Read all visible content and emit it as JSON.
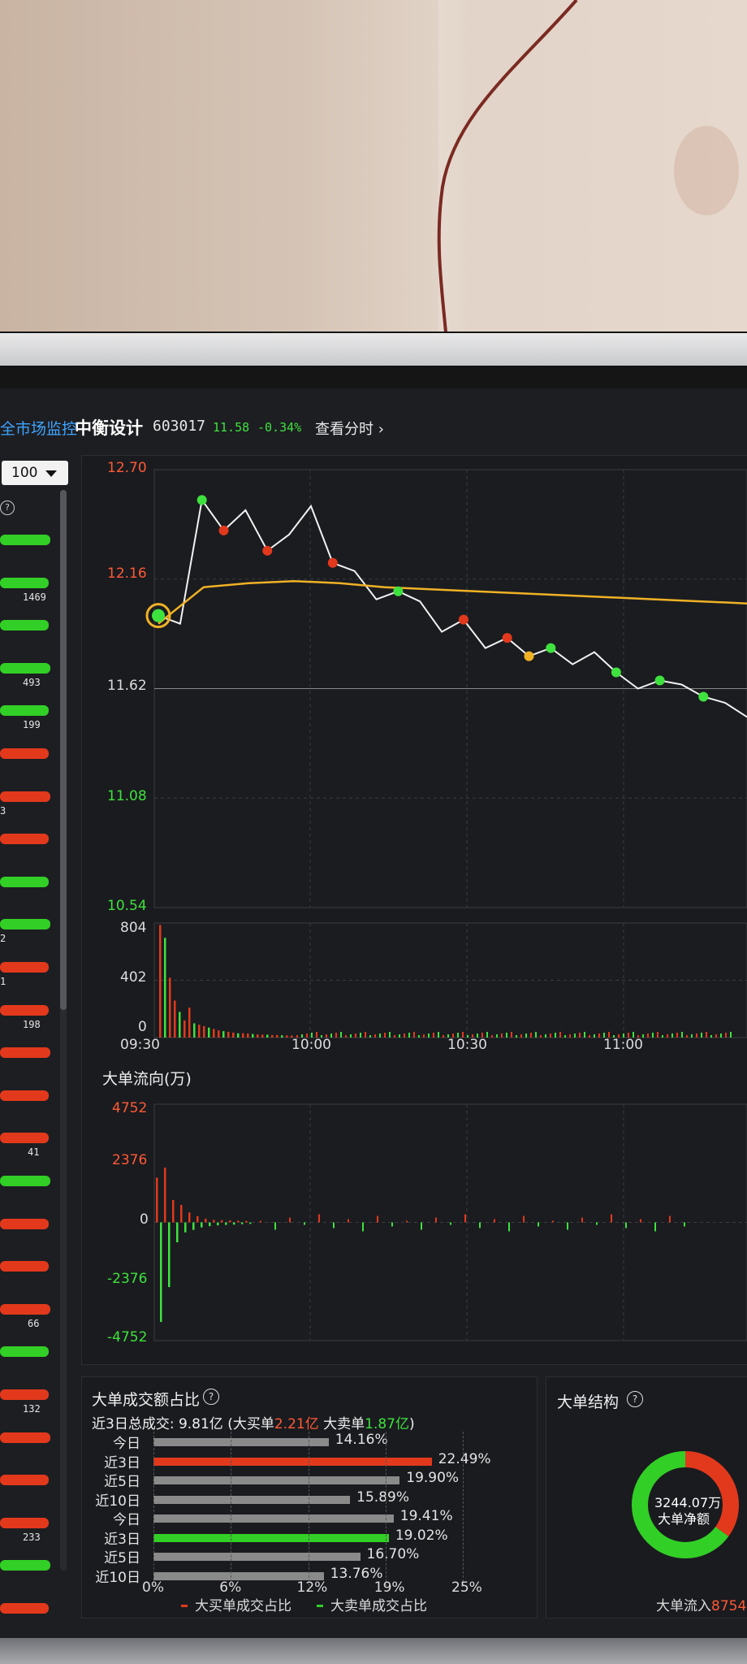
{
  "header": {
    "nav_link": "全市场监控",
    "stock_name": "中衡设计",
    "stock_code": "603017",
    "price": "11.58",
    "change": "-0.34%",
    "view_label": "查看分时 ›"
  },
  "left_panel": {
    "select_value": "100",
    "rows": [
      {
        "color": "green",
        "num": ""
      },
      {
        "color": "green",
        "num": "1469"
      },
      {
        "color": "green",
        "num": ""
      },
      {
        "color": "green",
        "num": "493"
      },
      {
        "color": "green",
        "num": "199"
      },
      {
        "color": "red",
        "num": ""
      },
      {
        "color": "red",
        "num": "3"
      },
      {
        "color": "red",
        "num": ""
      },
      {
        "color": "green",
        "num": ""
      },
      {
        "color": "green",
        "num": "2"
      },
      {
        "color": "red",
        "num": "1"
      },
      {
        "color": "red",
        "num": "198"
      },
      {
        "color": "red",
        "num": ""
      },
      {
        "color": "red",
        "num": ""
      },
      {
        "color": "red",
        "num": "41"
      },
      {
        "color": "green",
        "num": ""
      },
      {
        "color": "red",
        "num": ""
      },
      {
        "color": "red",
        "num": ""
      },
      {
        "color": "red",
        "num": "66"
      },
      {
        "color": "green",
        "num": ""
      },
      {
        "color": "red",
        "num": "132"
      },
      {
        "color": "red",
        "num": ""
      },
      {
        "color": "red",
        "num": ""
      },
      {
        "color": "red",
        "num": "233"
      },
      {
        "color": "green",
        "num": ""
      },
      {
        "color": "red",
        "num": ""
      }
    ]
  },
  "chart_data": [
    {
      "type": "line",
      "title": "",
      "y_ticks": [
        "12.70",
        "12.16",
        "11.62",
        "11.08",
        "10.54"
      ],
      "ylim": [
        10.54,
        12.7
      ],
      "x_ticks": [
        "09:30",
        "10:00",
        "10:30",
        "11:00"
      ],
      "series": [
        {
          "values": [
            11.98,
            11.94,
            12.55,
            12.4,
            12.5,
            12.3,
            12.38,
            12.52,
            12.24,
            12.2,
            12.06,
            12.1,
            12.05,
            11.9,
            11.96,
            11.82,
            11.87,
            11.78,
            11.82,
            11.74,
            11.8,
            11.7,
            11.62,
            11.66,
            11.64,
            11.58,
            11.55,
            11.48
          ]
        },
        {
          "values": [
            11.94,
            12.12,
            12.14,
            12.15,
            12.14,
            12.12,
            12.11,
            12.1,
            12.09,
            12.08,
            12.07,
            12.06,
            12.05,
            12.04
          ]
        }
      ]
    },
    {
      "type": "bar",
      "title": "",
      "y_ticks": [
        "804",
        "402",
        "0"
      ],
      "ylim": [
        0,
        804
      ],
      "x_ticks": [
        "09:30",
        "10:00",
        "10:30",
        "11:00"
      ],
      "values": [
        790,
        700,
        420,
        260,
        180,
        120,
        210,
        100,
        90,
        80,
        70,
        60,
        50,
        45,
        40,
        35,
        30,
        30,
        28,
        25,
        22,
        20,
        20,
        18,
        18,
        16,
        15,
        14
      ]
    },
    {
      "type": "bar",
      "title": "大单流向(万)",
      "y_ticks": [
        "4752",
        "2376",
        "0",
        "-2376",
        "-4752"
      ],
      "ylim": [
        -4752,
        4752
      ],
      "values": [
        1800,
        -4000,
        2200,
        -2600,
        900,
        -800,
        700,
        -400,
        400,
        -300,
        250,
        -200,
        150,
        -150,
        100,
        -120,
        90,
        -100,
        80,
        -90,
        70,
        -70,
        60,
        -60
      ]
    }
  ],
  "big_order_ratio": {
    "title": "大单成交额占比",
    "summary_prefix": "近3日总成交:",
    "summary_total": "9.81亿",
    "summary_buy_label": "(大买单",
    "summary_buy_value": "2.21亿",
    "summary_sell_label": "大卖单",
    "summary_sell_value": "1.87亿",
    "summary_close": ")",
    "rows": [
      {
        "label": "今日",
        "value": "14.16%",
        "pct": 14.16,
        "color": "grey"
      },
      {
        "label": "近3日",
        "value": "22.49%",
        "pct": 22.49,
        "color": "red"
      },
      {
        "label": "近5日",
        "value": "19.90%",
        "pct": 19.9,
        "color": "grey"
      },
      {
        "label": "近10日",
        "value": "15.89%",
        "pct": 15.89,
        "color": "grey"
      },
      {
        "label": "今日",
        "value": "19.41%",
        "pct": 19.41,
        "color": "grey"
      },
      {
        "label": "近3日",
        "value": "19.02%",
        "pct": 19.02,
        "color": "green"
      },
      {
        "label": "近5日",
        "value": "16.70%",
        "pct": 16.7,
        "color": "grey"
      },
      {
        "label": "近10日",
        "value": "13.76%",
        "pct": 13.76,
        "color": "grey"
      }
    ],
    "axis": [
      "0%",
      "6%",
      "12%",
      "19%",
      "25%"
    ],
    "legend_buy": "大买单成交占比",
    "legend_sell": "大卖单成交占比"
  },
  "big_order_structure": {
    "title": "大单结构",
    "center_value": "3244.07万",
    "center_label": "大单净额",
    "inflow_label": "大单流入",
    "inflow_value": "8754",
    "red_fraction": 0.35,
    "colors": {
      "red": "#e2391c",
      "green": "#32cf26"
    }
  }
}
